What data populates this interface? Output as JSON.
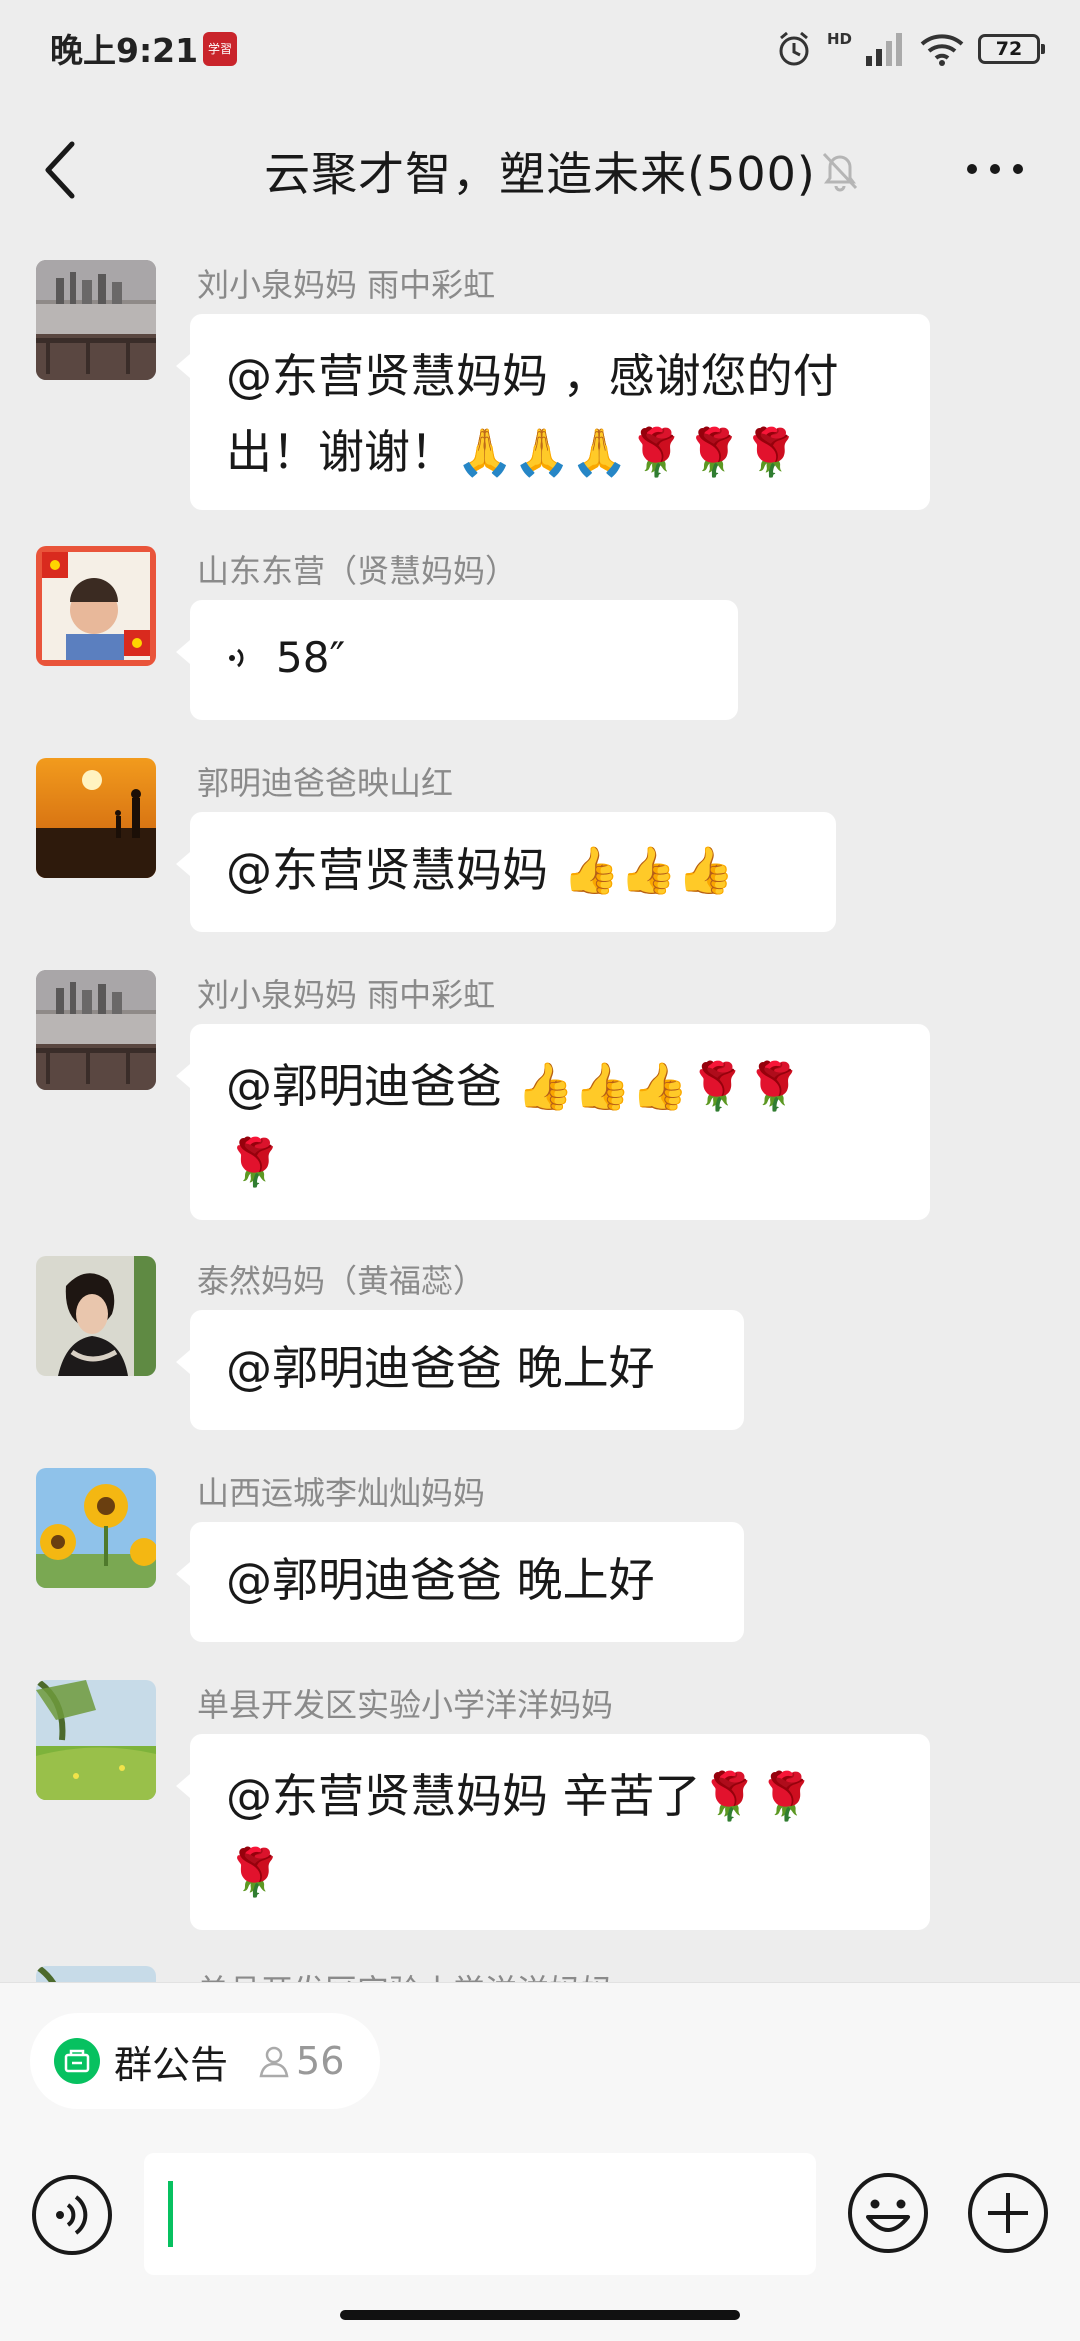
{
  "status": {
    "time": "晚上9:21",
    "app_badge": "学習",
    "network": "HD",
    "battery": "72"
  },
  "header": {
    "title": "云聚才智，塑造未来(500)",
    "back_icon": "chevron-left-icon",
    "mute_icon": "bell-muted-icon",
    "more_icon": "more-dots-icon"
  },
  "messages": [
    {
      "sender": "刘小泉妈妈  雨中彩虹",
      "lines": [
        "@东营贤慧妈妈 ，感谢您的付",
        "出！谢谢！🙏🙏🙏🌹🌹🌹"
      ],
      "avatar": "city-lake"
    },
    {
      "sender": "山东东营（贤慧妈妈）",
      "voice": "58″",
      "avatar": "child-flags"
    },
    {
      "sender": "郭明迪爸爸映山红",
      "lines": [
        "@东营贤慧妈妈 👍👍👍"
      ],
      "avatar": "sunset"
    },
    {
      "sender": "刘小泉妈妈  雨中彩虹",
      "lines": [
        "@郭明迪爸爸 👍👍👍🌹🌹",
        "🌹"
      ],
      "avatar": "city-lake"
    },
    {
      "sender": "泰然妈妈（黄福蕊）",
      "lines": [
        "@郭明迪爸爸  晚上好"
      ],
      "avatar": "woman-portrait"
    },
    {
      "sender": "山西运城李灿灿妈妈",
      "lines": [
        "@郭明迪爸爸  晚上好"
      ],
      "avatar": "sunflowers"
    },
    {
      "sender": "单县开发区实验小学洋洋妈妈",
      "lines": [
        "@东营贤慧妈妈  辛苦了🌹🌹",
        "🌹"
      ],
      "avatar": "green-field"
    },
    {
      "sender": "单县开发区实验小学洋洋妈妈",
      "lines": [],
      "avatar": "green-field"
    }
  ],
  "footer": {
    "notice_label": "群公告",
    "member_count": "56",
    "input_value": ""
  }
}
